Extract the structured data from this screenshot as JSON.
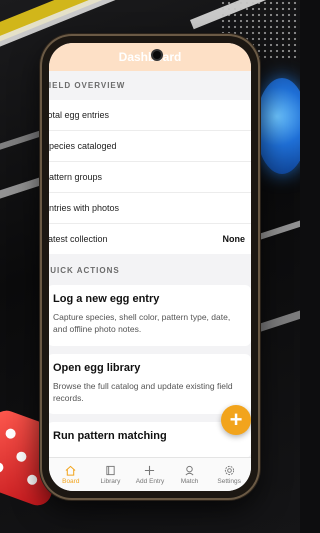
{
  "app": {
    "title": "Dashboard"
  },
  "overview": {
    "header": "FIELD OVERVIEW",
    "rows": [
      {
        "label": "Total egg entries",
        "value": ""
      },
      {
        "label": "Species cataloged",
        "value": ""
      },
      {
        "label": "Pattern groups",
        "value": ""
      },
      {
        "label": "Entries with photos",
        "value": ""
      },
      {
        "label": "Latest collection",
        "value": "None"
      }
    ]
  },
  "quick_actions": {
    "header": "QUICK ACTIONS",
    "cards": [
      {
        "title": "Log a new egg entry",
        "desc": "Capture species, shell color, pattern type, date, and offline photo notes."
      },
      {
        "title": "Open egg library",
        "desc": "Browse the full catalog and update existing field records."
      },
      {
        "title": "Run pattern matching",
        "desc": ""
      }
    ]
  },
  "fab": {
    "icon": "plus-icon",
    "color": "#f2a41c"
  },
  "nav": [
    {
      "label": "Board",
      "icon": "home-icon",
      "active": true
    },
    {
      "label": "Library",
      "icon": "book-icon",
      "active": false
    },
    {
      "label": "Add Entry",
      "icon": "plus-icon",
      "active": false
    },
    {
      "label": "Match",
      "icon": "search-icon",
      "active": false
    },
    {
      "label": "Settings",
      "icon": "gear-icon",
      "active": false
    }
  ],
  "colors": {
    "accent": "#f2a41c",
    "appbar": "#fde0c6"
  }
}
